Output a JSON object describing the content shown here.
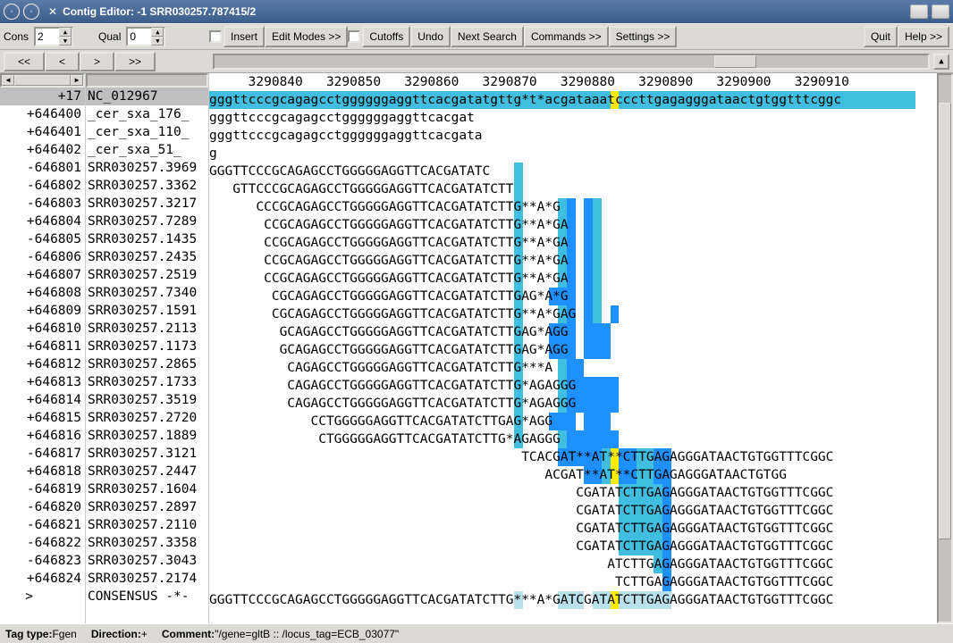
{
  "window": {
    "title": "Contig Editor:      -1 SRR030257.787415/2"
  },
  "toolbar": {
    "cons_label": "Cons",
    "cons_value": "2",
    "qual_label": "Qual",
    "qual_value": "0",
    "insert": "Insert",
    "edit_modes": "Edit Modes >>",
    "cutoffs": "Cutoffs",
    "undo": "Undo",
    "next_search": "Next Search",
    "commands": "Commands >>",
    "settings": "Settings >>",
    "quit": "Quit",
    "help": "Help >>"
  },
  "nav": {
    "first": "<<",
    "prev": "<",
    "next": ">",
    "last": ">>"
  },
  "ruler": "     3290840   3290850   3290860   3290870   3290880   3290890   3290900   3290910 ",
  "rows": [
    {
      "num": "+17",
      "name": "NC_012967    ",
      "seq": "gggttcccgcagagcctggggggaggttcacgatatgttg*t*acgataaatcccttgagagggataactgtggtttcggc",
      "ref": true
    },
    {
      "num": "+646400",
      "name": "_cer_sxa_176_",
      "seq": "gggttcccgcagagcctggggggaggttcacgat"
    },
    {
      "num": "+646401",
      "name": "_cer_sxa_110_",
      "seq": "gggttcccgcagagcctggggggaggttcacgata"
    },
    {
      "num": "+646402",
      "name": "_cer_sxa_51_ ",
      "seq": "g"
    },
    {
      "num": "-646801",
      "name": "SRR030257.3969",
      "seq": "GGGTTCCCGCAGAGCCTGGGGGAGGTTCACGATATC",
      "hl": [
        [
          35,
          36,
          "cyan"
        ]
      ]
    },
    {
      "num": "-646802",
      "name": "SRR030257.3362",
      "seq": "   GTTCCCGCAGAGCCTGGGGGAGGTTCACGATATCTT",
      "hl": [
        [
          35,
          36,
          "cyan"
        ]
      ]
    },
    {
      "num": "-646803",
      "name": "SRR030257.3217",
      "seq": "      CCCGCAGAGCCTGGGGGAGGTTCACGATATCTTG**A*G",
      "hl": [
        [
          35,
          36,
          "cyan"
        ],
        [
          40,
          41,
          "cyan"
        ],
        [
          41,
          42,
          "blue"
        ],
        [
          43,
          44,
          "blue"
        ],
        [
          44,
          45,
          "cyan"
        ]
      ]
    },
    {
      "num": "+646804",
      "name": "SRR030257.7289",
      "seq": "       CCGCAGAGCCTGGGGGAGGTTCACGATATCTTG**A*GA",
      "hl": [
        [
          35,
          36,
          "cyan"
        ],
        [
          40,
          41,
          "cyan"
        ],
        [
          41,
          42,
          "blue"
        ],
        [
          43,
          44,
          "blue"
        ],
        [
          44,
          45,
          "cyan"
        ]
      ]
    },
    {
      "num": "-646805",
      "name": "SRR030257.1435",
      "seq": "       CCGCAGAGCCTGGGGGAGGTTCACGATATCTTG**A*GA",
      "hl": [
        [
          35,
          36,
          "cyan"
        ],
        [
          40,
          41,
          "cyan"
        ],
        [
          41,
          42,
          "blue"
        ],
        [
          43,
          44,
          "blue"
        ],
        [
          44,
          45,
          "cyan"
        ]
      ]
    },
    {
      "num": "-646806",
      "name": "SRR030257.2435",
      "seq": "       CCGCAGAGCCTGGGGGAGGTTCACGATATCTTG**A*GA",
      "hl": [
        [
          35,
          36,
          "cyan"
        ],
        [
          40,
          41,
          "cyan"
        ],
        [
          41,
          42,
          "blue"
        ],
        [
          43,
          44,
          "blue"
        ],
        [
          44,
          45,
          "cyan"
        ]
      ]
    },
    {
      "num": "+646807",
      "name": "SRR030257.2519",
      "seq": "       CCGCAGAGCCTGGGGGAGGTTCACGATATCTTG**A*GA",
      "hl": [
        [
          35,
          36,
          "cyan"
        ],
        [
          40,
          41,
          "cyan"
        ],
        [
          41,
          42,
          "blue"
        ],
        [
          43,
          44,
          "blue"
        ],
        [
          44,
          45,
          "cyan"
        ]
      ]
    },
    {
      "num": "+646808",
      "name": "SRR030257.7340",
      "seq": "        CGCAGAGCCTGGGGGAGGTTCACGATATCTTGAG*A*G",
      "hl": [
        [
          35,
          36,
          "cyan"
        ],
        [
          39,
          42,
          "blue"
        ],
        [
          43,
          44,
          "blue"
        ],
        [
          44,
          45,
          "cyan"
        ]
      ]
    },
    {
      "num": "+646809",
      "name": "SRR030257.1591",
      "seq": "        CGCAGAGCCTGGGGGAGGTTCACGATATCTTG**A*GAG",
      "hl": [
        [
          35,
          36,
          "cyan"
        ],
        [
          40,
          41,
          "cyan"
        ],
        [
          41,
          42,
          "blue"
        ],
        [
          43,
          44,
          "blue"
        ],
        [
          44,
          45,
          "cyan"
        ],
        [
          46,
          47,
          "blue"
        ]
      ]
    },
    {
      "num": "+646810",
      "name": "SRR030257.2113",
      "seq": "         GCAGAGCCTGGGGGAGGTTCACGATATCTTGAG*AGG",
      "hl": [
        [
          35,
          36,
          "cyan"
        ],
        [
          39,
          42,
          "blue"
        ],
        [
          43,
          46,
          "blue"
        ]
      ]
    },
    {
      "num": "+646811",
      "name": "SRR030257.1173",
      "seq": "         GCAGAGCCTGGGGGAGGTTCACGATATCTTGAG*AGG",
      "hl": [
        [
          35,
          36,
          "cyan"
        ],
        [
          39,
          42,
          "blue"
        ],
        [
          43,
          46,
          "blue"
        ]
      ]
    },
    {
      "num": "+646812",
      "name": "SRR030257.2865",
      "seq": "          CAGAGCCTGGGGGAGGTTCACGATATCTTG***A",
      "hl": [
        [
          35,
          36,
          "cyan"
        ],
        [
          40,
          41,
          "cyan"
        ],
        [
          41,
          43,
          "blue"
        ]
      ]
    },
    {
      "num": "+646813",
      "name": "SRR030257.1733",
      "seq": "          CAGAGCCTGGGGGAGGTTCACGATATCTTG*AGAGGG",
      "hl": [
        [
          35,
          36,
          "cyan"
        ],
        [
          40,
          41,
          "cyan"
        ],
        [
          41,
          47,
          "blue"
        ]
      ]
    },
    {
      "num": "+646814",
      "name": "SRR030257.3519",
      "seq": "          CAGAGCCTGGGGGAGGTTCACGATATCTTG*AGAGGG",
      "hl": [
        [
          35,
          36,
          "cyan"
        ],
        [
          40,
          41,
          "cyan"
        ],
        [
          41,
          47,
          "blue"
        ]
      ]
    },
    {
      "num": "+646815",
      "name": "SRR030257.2720",
      "seq": "             CCTGGGGGAGGTTCACGATATCTTGAG*AGG",
      "hl": [
        [
          35,
          36,
          "cyan"
        ],
        [
          39,
          42,
          "blue"
        ],
        [
          43,
          46,
          "blue"
        ]
      ]
    },
    {
      "num": "+646816",
      "name": "SRR030257.1889",
      "seq": "              CTGGGGGAGGTTCACGATATCTTG*AGAGGG",
      "hl": [
        [
          35,
          36,
          "cyan"
        ],
        [
          40,
          41,
          "cyan"
        ],
        [
          41,
          47,
          "blue"
        ]
      ]
    },
    {
      "num": "-646817",
      "name": "SRR030257.3121",
      "seq": "                                        TCACGAT**AT**CTTGAGAGGGATAACTGTGGTTTCGGC",
      "hl": [
        [
          40,
          45,
          "blue"
        ],
        [
          45,
          47,
          "cyan"
        ],
        [
          46,
          47,
          "yellow"
        ],
        [
          47,
          49,
          "blue"
        ],
        [
          49,
          51,
          "cyan"
        ],
        [
          51,
          53,
          "blue"
        ]
      ]
    },
    {
      "num": "+646818",
      "name": "SRR030257.2447",
      "seq": "                                           ACGAT**AT**CTTGAGAGGGATAACTGTGG",
      "hl": [
        [
          43,
          45,
          "blue"
        ],
        [
          45,
          47,
          "cyan"
        ],
        [
          46,
          47,
          "yellow"
        ],
        [
          47,
          49,
          "blue"
        ],
        [
          49,
          51,
          "cyan"
        ],
        [
          51,
          53,
          "blue"
        ]
      ]
    },
    {
      "num": "-646819",
      "name": "SRR030257.1604",
      "seq": "                                               CGATATCTTGAGAGGGATAACTGTGGTTTCGGC",
      "hl": [
        [
          47,
          52,
          "cyan"
        ],
        [
          52,
          53,
          "blue"
        ]
      ]
    },
    {
      "num": "-646820",
      "name": "SRR030257.2897",
      "seq": "                                               CGATATCTTGAGAGGGATAACTGTGGTTTCGGC",
      "hl": [
        [
          47,
          52,
          "cyan"
        ],
        [
          52,
          53,
          "blue"
        ]
      ]
    },
    {
      "num": "-646821",
      "name": "SRR030257.2110",
      "seq": "                                               CGATATCTTGAGAGGGATAACTGTGGTTTCGGC",
      "hl": [
        [
          47,
          52,
          "cyan"
        ],
        [
          52,
          53,
          "blue"
        ]
      ]
    },
    {
      "num": "-646822",
      "name": "SRR030257.3358",
      "seq": "                                               CGATATCTTGAGAGGGATAACTGTGGTTTCGGC",
      "hl": [
        [
          47,
          52,
          "cyan"
        ],
        [
          52,
          53,
          "blue"
        ]
      ]
    },
    {
      "num": "-646823",
      "name": "SRR030257.3043",
      "seq": "                                                   ATCTTGAGAGGGATAACTGTGGTTTCGGC",
      "hl": [
        [
          51,
          52,
          "cyan"
        ],
        [
          52,
          53,
          "blue"
        ]
      ]
    },
    {
      "num": "+646824",
      "name": "SRR030257.2174",
      "seq": "                                                    TCTTGAGAGGGATAACTGTGGTTTCGGC",
      "hl": [
        [
          52,
          53,
          "blue"
        ]
      ]
    }
  ],
  "consensus": {
    "marker": "   >   ",
    "name": "CONSENSUS -*-",
    "seq": "GGGTTCCCGCAGAGCCTGGGGGAGGTTCACGATATCTTG***A*GATCGATATCTTGAGAGGGATAACTGTGGTTTCGGC",
    "hl": [
      [
        35,
        36,
        "pale"
      ],
      [
        40,
        43,
        "pale"
      ],
      [
        44,
        47,
        "pale"
      ],
      [
        46,
        47,
        "yellow"
      ],
      [
        47,
        52,
        "pale"
      ],
      [
        52,
        53,
        "pale"
      ]
    ]
  },
  "status": {
    "tag_type_label": "Tag type:",
    "tag_type": "Fgen",
    "direction_label": "Direction:",
    "direction": "+",
    "comment_label": "Comment:",
    "comment": "\"/gene=gltB :: /locus_tag=ECB_03077\""
  }
}
